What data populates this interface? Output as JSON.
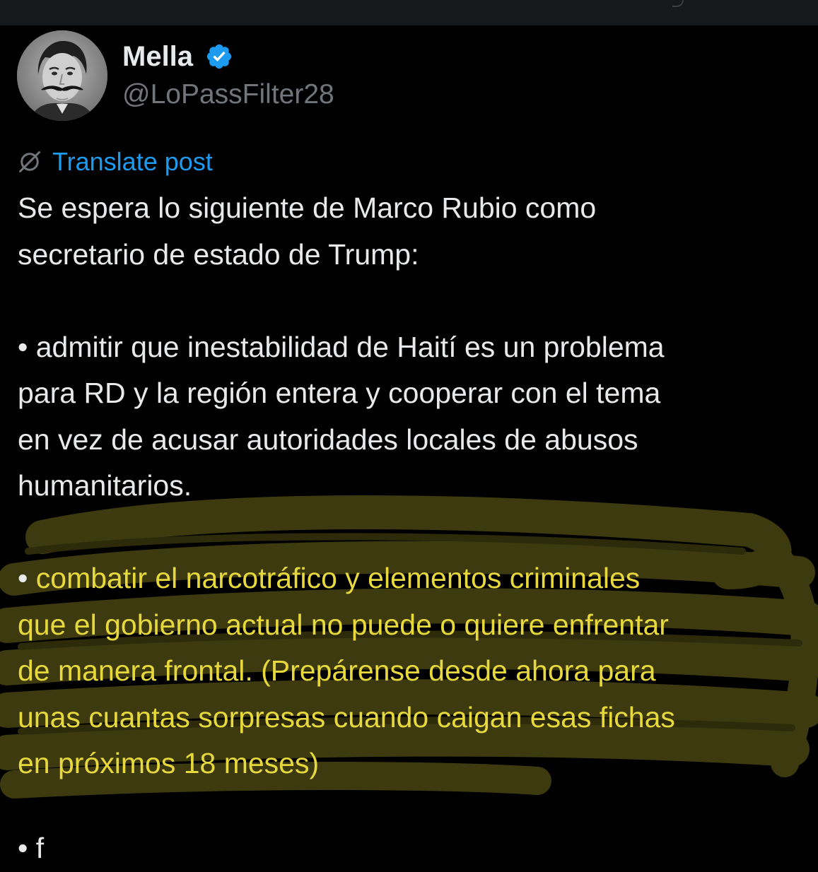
{
  "author": {
    "display_name": "Mella",
    "handle": "@LoPassFilter28",
    "avatar_icon": "portrait-avatar",
    "verified_icon": "verified-badge-icon",
    "verified_color": "#1d9bf0"
  },
  "translate": {
    "icon": "globe-slash-icon",
    "label": "Translate post",
    "color": "#1d9bf0"
  },
  "post": {
    "lines": [
      "Se espera lo siguiente de Marco Rubio como",
      "secretario de estado de Trump:",
      "",
      "• admitir que inestabilidad de Haití es un problema",
      "para RD y la región entera y cooperar con el tema",
      "en vez de acusar autoridades locales de abusos",
      "humanitarios.",
      "",
      "combatir el narcotráfico y elementos criminales",
      "que el gobierno actual no puede o quiere enfrentar",
      "de manera frontal. (Prepárense desde ahora para",
      "unas cuantas sorpresas cuando caigan esas fichas",
      "en próximos 18 meses)"
    ],
    "bullet": "•",
    "highlight_color": "#e7d83c",
    "cut_off_line": "• f"
  }
}
